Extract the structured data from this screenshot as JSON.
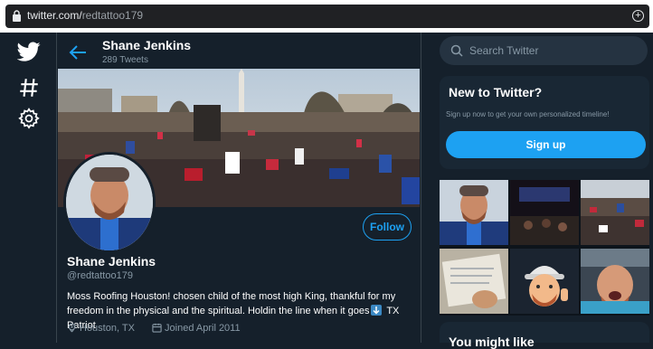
{
  "browser": {
    "url_host": "twitter.com/",
    "url_path": "redtattoo179"
  },
  "nav": {
    "icons": [
      "twitter-bird-icon",
      "hashtag-icon",
      "gear-icon"
    ]
  },
  "header": {
    "name": "Shane Jenkins",
    "tweet_count": "289 Tweets"
  },
  "profile": {
    "follow_label": "Follow",
    "name": "Shane Jenkins",
    "handle": "@redtattoo179",
    "bio_part1": "Moss Roofing Houston! chosen child of the most high King, thankful for my freedom in the physical and the spiritual. Holdin the line when it goes",
    "bio_part2": " TX Patriot",
    "location": "Houston, TX",
    "joined": "Joined April 2011"
  },
  "sidebar": {
    "search_placeholder": "Search Twitter",
    "new_title": "New to Twitter?",
    "new_sub": "Sign up now to get your own personalized timeline!",
    "signup_label": "Sign up",
    "might_like": "You might like"
  },
  "colors": {
    "accent": "#1da1f2",
    "background": "#15202b",
    "secondary_text": "#8899a6"
  }
}
